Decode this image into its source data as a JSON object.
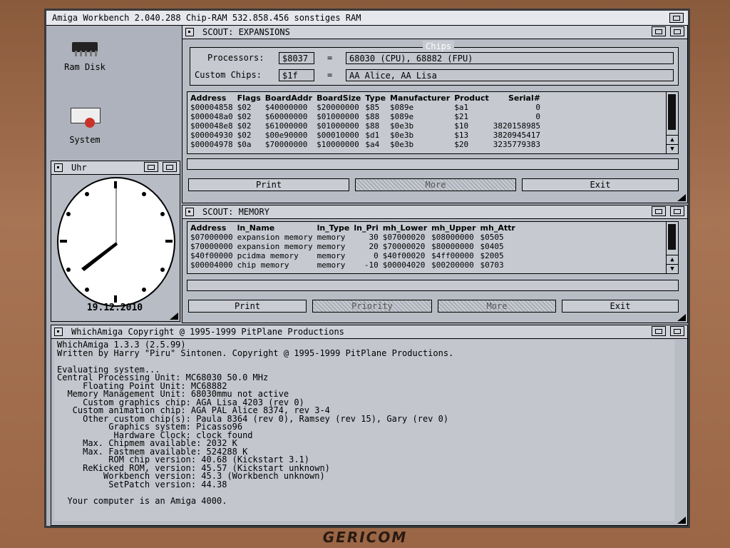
{
  "workbench": {
    "title": "Amiga Workbench  2.040.288 Chip-RAM  532.858.456 sonstiges RAM",
    "icons": [
      {
        "label": "Ram Disk",
        "icon": "chip-icon"
      },
      {
        "label": "System",
        "icon": "disk-drive-icon"
      }
    ]
  },
  "clock": {
    "title": "Uhr",
    "date": "19.12.2010"
  },
  "expansions": {
    "title": "SCOUT: EXPANSIONS",
    "chips_group": "Chips",
    "processors_label": "Processors:",
    "processors_value": "$8037",
    "processors_desc": "68030 (CPU), 68882 (FPU)",
    "custom_label": "Custom Chips:",
    "custom_value": "$1f",
    "custom_desc": "AA Alice, AA Lisa",
    "equals": "=",
    "columns": [
      "Address",
      "Flags",
      "BoardAddr",
      "BoardSize",
      "Type",
      "Manufacturer",
      "Product",
      "Serial#"
    ],
    "rows": [
      [
        "$00004858",
        "$02",
        "$40000000",
        "$20000000",
        "$85",
        "$089e",
        "$a1",
        "0"
      ],
      [
        "$000048a0",
        "$02",
        "$60000000",
        "$01000000",
        "$88",
        "$089e",
        "$21",
        "0"
      ],
      [
        "$000048e8",
        "$02",
        "$61000000",
        "$01000000",
        "$88",
        "$0e3b",
        "$10",
        "3820158985"
      ],
      [
        "$00004930",
        "$02",
        "$00e90000",
        "$00010000",
        "$d1",
        "$0e3b",
        "$13",
        "3820945417"
      ],
      [
        "$00004978",
        "$0a",
        "$70000000",
        "$10000000",
        "$a4",
        "$0e3b",
        "$20",
        "3235779383"
      ]
    ],
    "buttons": {
      "print": "Print",
      "more": "More",
      "exit": "Exit"
    }
  },
  "memory": {
    "title": "SCOUT: MEMORY",
    "columns": [
      "Address",
      "ln_Name",
      "ln_Type",
      "ln_Pri",
      "mh_Lower",
      "mh_Upper",
      "mh_Attr"
    ],
    "rows": [
      [
        "$07000000",
        "expansion memory",
        "memory",
        "30",
        "$07000020",
        "$08000000",
        "$0505"
      ],
      [
        "$70000000",
        "expansion memory",
        "memory",
        "20",
        "$70000020",
        "$80000000",
        "$0405"
      ],
      [
        "$40f00000",
        "pcidma memory",
        "memory",
        "0",
        "$40f00020",
        "$4ff00000",
        "$2005"
      ],
      [
        "$00004000",
        "chip memory",
        "memory",
        "-10",
        "$00004020",
        "$00200000",
        "$0703"
      ]
    ],
    "buttons": {
      "print": "Print",
      "priority": "Priority",
      "more": "More",
      "exit": "Exit"
    }
  },
  "whichamiga": {
    "title": "WhichAmiga  Copyright @ 1995-1999 PitPlane Productions",
    "lines": [
      "WhichAmiga 1.3.3 (2.5.99)",
      "Written by Harry \"Piru\" Sintonen. Copyright @ 1995-1999 PitPlane Productions.",
      "",
      "Evaluating system...",
      "Central Processing Unit: MC68030 50.0 MHz",
      "     Floating Point Unit: MC68882",
      "  Memory Management Unit: 68030mmu not active",
      "     Custom graphics chip: AGA Lisa 4203 (rev 0)",
      "   Custom animation chip: AGA PAL Alice 8374, rev 3-4",
      "     Other custom chip(s): Paula 8364 (rev 0), Ramsey (rev 15), Gary (rev 0)",
      "          Graphics system: Picasso96",
      "           Hardware Clock: clock found",
      "     Max. Chipmem available: 2032 K",
      "     Max. Fastmem available: 524288 K",
      "          ROM chip version: 40.68 (Kickstart 3.1)",
      "     ReKicked ROM, version: 45.57 (Kickstart unknown)",
      "         Workbench version: 45.3 (Workbench unknown)",
      "          SetPatch version: 44.38",
      "",
      "  Your computer is an Amiga 4000."
    ]
  },
  "monitor": {
    "brand": "GERICOM"
  }
}
